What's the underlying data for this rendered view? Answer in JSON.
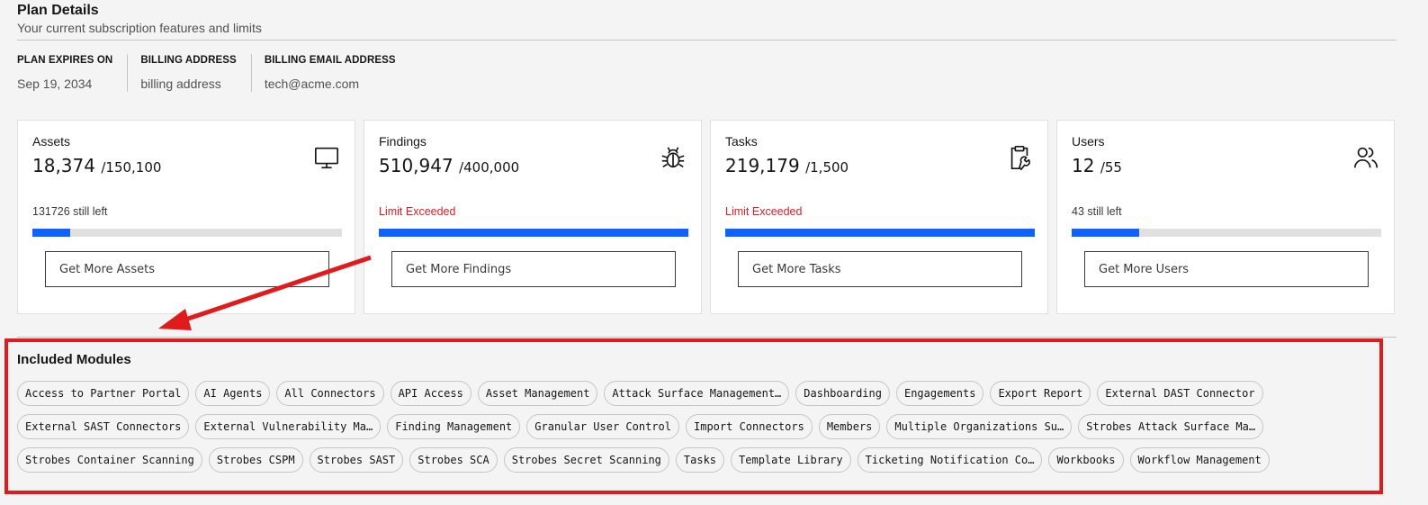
{
  "header": {
    "title": "Plan Details",
    "subtitle": "Your current subscription features and limits"
  },
  "meta": {
    "plan_expires_label": "PLAN EXPIRES ON",
    "plan_expires_value": "Sep 19, 2034",
    "billing_address_label": "BILLING ADDRESS",
    "billing_address_value": "billing address",
    "billing_email_label": "BILLING EMAIL ADDRESS",
    "billing_email_value": "tech@acme.com"
  },
  "cards": [
    {
      "name": "Assets",
      "used": "18,374",
      "limit": "/150,100",
      "status": "131726 still left",
      "exceeded": false,
      "fill_pct": 12.2,
      "button": "Get More Assets",
      "icon": "monitor-icon"
    },
    {
      "name": "Findings",
      "used": "510,947",
      "limit": "/400,000",
      "status": "Limit Exceeded",
      "exceeded": true,
      "fill_pct": 100,
      "button": "Get More Findings",
      "icon": "bug-icon"
    },
    {
      "name": "Tasks",
      "used": "219,179",
      "limit": "/1,500",
      "status": "Limit Exceeded",
      "exceeded": true,
      "fill_pct": 100,
      "button": "Get More Tasks",
      "icon": "clipboard-wrench-icon"
    },
    {
      "name": "Users",
      "used": "12",
      "limit": "/55",
      "status": "43 still left",
      "exceeded": false,
      "fill_pct": 21.8,
      "button": "Get More Users",
      "icon": "users-icon"
    }
  ],
  "modules": {
    "title": "Included Modules",
    "tags": [
      "Access to Partner Portal",
      "AI Agents",
      "All Connectors",
      "API Access",
      "Asset Management",
      "Attack Surface Management…",
      "Dashboarding",
      "Engagements",
      "Export Report",
      "External DAST Connector",
      "External SAST Connectors",
      "External Vulnerability Ma…",
      "Finding Management",
      "Granular User Control",
      "Import Connectors",
      "Members",
      "Multiple Organizations Su…",
      "Strobes Attack Surface Ma…",
      "Strobes Container Scanning",
      "Strobes CSPM",
      "Strobes SAST",
      "Strobes SCA",
      "Strobes Secret Scanning",
      "Tasks",
      "Template Library",
      "Ticketing Notification Co…",
      "Workbooks",
      "Workflow Management"
    ]
  },
  "colors": {
    "accent": "#0f62fe",
    "danger": "#da1e28",
    "annotation": "#e01b1b"
  }
}
